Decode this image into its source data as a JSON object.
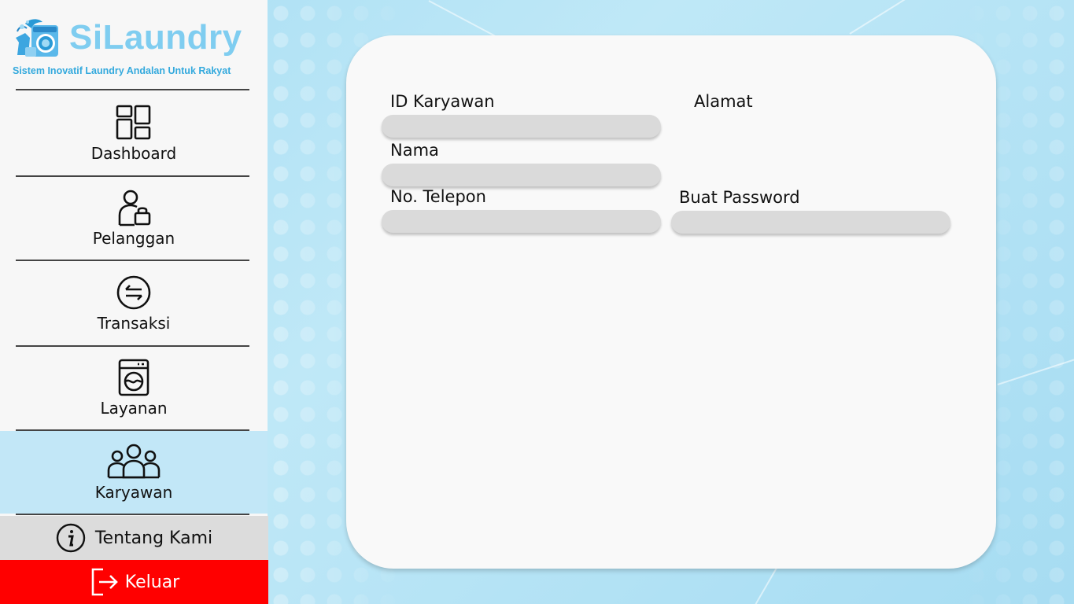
{
  "app": {
    "logo_title": "SiLaundry",
    "logo_subtitle": "Sistem Inovatif Laundry Andalan Untuk Rakyat"
  },
  "sidebar": {
    "items": [
      {
        "label": "Dashboard",
        "icon": "dashboard-icon",
        "active": false
      },
      {
        "label": "Pelanggan",
        "icon": "customer-icon",
        "active": false
      },
      {
        "label": "Transaksi",
        "icon": "transaction-icon",
        "active": false
      },
      {
        "label": "Layanan",
        "icon": "washing-machine-icon",
        "active": false
      },
      {
        "label": "Karyawan",
        "icon": "employees-icon",
        "active": true
      }
    ],
    "about_label": "Tentang Kami",
    "logout_label": "Keluar"
  },
  "form": {
    "id_label": "ID Karyawan",
    "id_value": "",
    "name_label": "Nama",
    "name_value": "",
    "phone_label": "No. Telepon",
    "phone_value": "",
    "address_label": "Alamat",
    "password_label": "Buat Password",
    "password_value": ""
  },
  "colors": {
    "active_nav": "#c2e7f7",
    "logout": "#ff0000",
    "brand": "#7fcdf0",
    "input_bg": "#dadada"
  }
}
